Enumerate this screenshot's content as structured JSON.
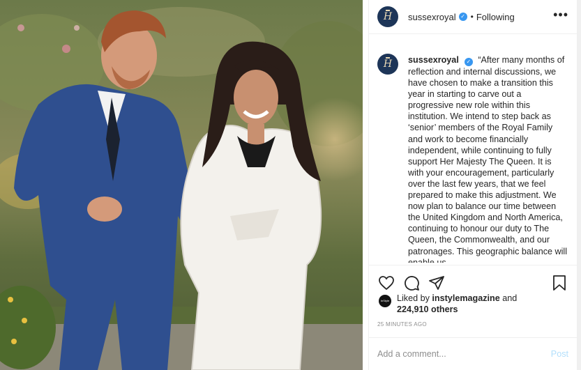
{
  "post": {
    "username": "sussexroyal",
    "verified_mark": "✓",
    "follow_separator": "•",
    "follow_status": "Following",
    "more_icon": "more-options-icon",
    "avatar_monogram": "H",
    "caption": "“After many months of reflection and internal discussions, we have chosen to make a transition this year in starting to carve out a progressive new role within this institution. We intend to step back as ‘senior’ members of the Royal Family and work to become financially independent, while continuing to fully support Her Majesty The Queen. It is with your encouragement, particularly over the last few years, that we feel prepared to make this adjustment. We now plan to balance our time between the United Kingdom and North America, continuing to honour our duty to The Queen, the Commonwealth, and our patronages. This geographic balance will enable us",
    "likes_prefix": "Liked by",
    "liked_by": "instylemagazine",
    "likes_and": "and",
    "likes_count": "224,910 others",
    "liker_avatar_text": "InStyle",
    "timestamp": "25 minutes ago",
    "comment_placeholder": "Add a comment...",
    "post_label": "Post"
  },
  "icons": {
    "like": "heart-icon",
    "comment": "comment-bubble-icon",
    "share": "paper-plane-icon",
    "save": "bookmark-icon"
  },
  "colors": {
    "verified_blue": "#3897f0",
    "post_button_disabled": "#b2dffc",
    "avatar_navy": "#1d3558",
    "border": "#efefef",
    "muted_text": "#8e8e8e"
  }
}
